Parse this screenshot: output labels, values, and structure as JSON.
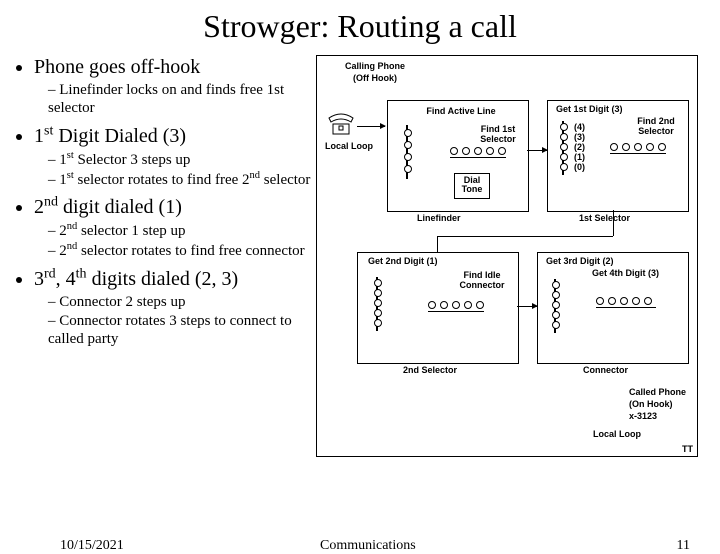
{
  "title": "Strowger: Routing a call",
  "bullets": [
    {
      "text": "Phone goes off-hook",
      "sub": [
        "Linefinder locks on and finds free 1st selector"
      ]
    },
    {
      "text": "1st Digit Dialed (3)",
      "sub": [
        "1st Selector 3 steps up",
        "1st selector rotates to find free 2nd selector"
      ]
    },
    {
      "text": "2nd digit dialed (1)",
      "sub": [
        "2nd selector 1 step up",
        "2nd selector rotates to find free connector"
      ]
    },
    {
      "text": "3rd, 4th digits dialed (2, 3)",
      "sub": [
        "Connector 2 steps up",
        "Connector rotates 3 steps to connect to called party"
      ]
    }
  ],
  "diagram": {
    "calling_phone": "Calling Phone",
    "off_hook": "(Off Hook)",
    "local_loop": "Local Loop",
    "find_active": "Find Active Line",
    "find_1st": "Find 1st Selector",
    "dial_tone": "Dial Tone",
    "linefinder": "Linefinder",
    "get_1st_digit": "Get 1st Digit (3)",
    "find_2nd": "Find 2nd Selector",
    "first_selector": "1st Selector",
    "lvl4": "(4)",
    "lvl3": "(3)",
    "lvl2": "(2)",
    "lvl1": "(1)",
    "lvl0": "(0)",
    "get_2nd_digit": "Get 2nd Digit (1)",
    "find_idle": "Find Idle Connector",
    "second_selector": "2nd Selector",
    "get_3rd_digit": "Get 3rd Digit (2)",
    "get_4th_digit": "Get 4th Digit (3)",
    "connector": "Connector",
    "called_phone": "Called Phone",
    "on_hook": "(On Hook)",
    "called_num": "x-3123",
    "local_loop2": "Local Loop",
    "tt": "TT"
  },
  "footer": {
    "date": "10/15/2021",
    "title": "Communications",
    "page": "11"
  }
}
